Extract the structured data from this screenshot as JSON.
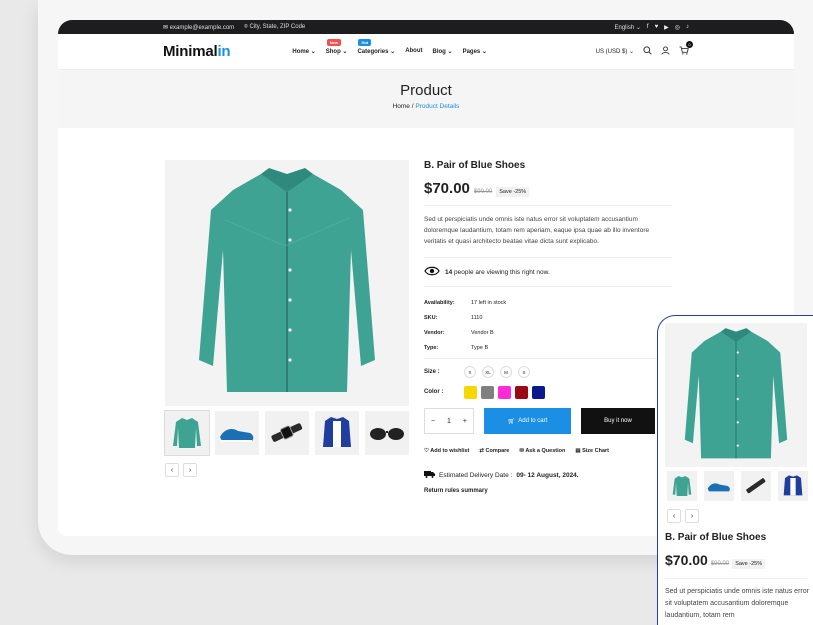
{
  "topbar": {
    "email": "example@example.com",
    "location": "City, State, ZIP Code",
    "language": "English"
  },
  "header": {
    "logo_main": "Minimal",
    "logo_accent": "in",
    "nav": [
      {
        "label": "Home",
        "caret": true
      },
      {
        "label": "Shop",
        "caret": true,
        "badge": "New",
        "badge_color": "#f0504f"
      },
      {
        "label": "Categories",
        "caret": true,
        "badge": "Hot",
        "badge_color": "#1a8fe3"
      },
      {
        "label": "About",
        "caret": false
      },
      {
        "label": "Blog",
        "caret": true
      },
      {
        "label": "Pages",
        "caret": true
      }
    ],
    "currency": "US (USD $)",
    "cart_count": "0"
  },
  "banner": {
    "title": "Product",
    "crumb_home": "Home",
    "crumb_sep": "/",
    "crumb_current": "Product Details"
  },
  "product": {
    "title": "B. Pair of Blue Shoes",
    "price": "$70.00",
    "old_price": "$90.00",
    "save": "Save -25%",
    "description": "Sed ut perspiciatis unde omnis iste natus error sit voluptatem accusantium doloremque laudantium, totam rem aperiam, eaque ipsa quae ab illo inventore veritatis et quasi architecto beatae vitae dicta sunt explicabo.",
    "viewing_count": "14",
    "viewing_text": "people are viewing this right now.",
    "meta": [
      {
        "key": "Availability:",
        "value": "17 left in stock"
      },
      {
        "key": "SKU:",
        "value": "1110"
      },
      {
        "key": "Vendor:",
        "value": "Vendor B"
      },
      {
        "key": "Type:",
        "value": "Type B"
      }
    ],
    "size_label": "Size :",
    "sizes": [
      "X",
      "XL",
      "M",
      "S"
    ],
    "color_label": "Color :",
    "colors": [
      "#f5d800",
      "#808080",
      "#ff2bd6",
      "#9b0a14",
      "#0a1a8c"
    ],
    "qty": "1",
    "add_to_cart": "Add to cart",
    "buy_now": "Buy it now",
    "actions": [
      "Add to wishlist",
      "Compare",
      "Ask a Question",
      "Size Chart"
    ],
    "delivery_label": "Estimated Delivery Date :",
    "delivery_date": "09- 12 August, 2024.",
    "returns": "Return rules summary"
  },
  "phone": {
    "title": "B. Pair of Blue Shoes",
    "price": "$70.00",
    "old_price": "$90.00",
    "save": "Save -25%",
    "description": "Sed ut perspiciatis unde omnis iste natus error sit voluptatem accusantium doloremque laudantium, totam rem"
  },
  "colors": {
    "accent": "#1a8fe3",
    "shirt": "#3fa394"
  }
}
